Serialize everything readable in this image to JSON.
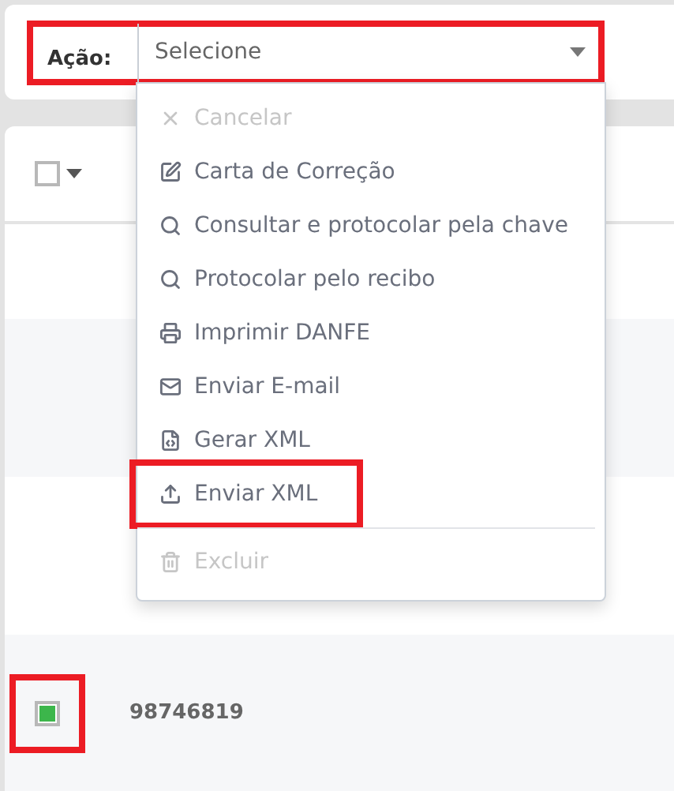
{
  "action_bar": {
    "label": "Ação:",
    "highlighted": true,
    "select": {
      "value": "Selecione",
      "expanded": true
    }
  },
  "menu": [
    {
      "kind": "times",
      "label": "Cancelar",
      "disabled": true,
      "highlighted": false
    },
    {
      "kind": "edit",
      "label": "Carta de Correção",
      "disabled": false,
      "highlighted": false
    },
    {
      "kind": "search",
      "label": "Consultar e protocolar pela chave",
      "disabled": false,
      "highlighted": false
    },
    {
      "kind": "search",
      "label": "Protocolar pelo recibo",
      "disabled": false,
      "highlighted": false
    },
    {
      "kind": "print",
      "label": "Imprimir DANFE",
      "disabled": false,
      "highlighted": false
    },
    {
      "kind": "mail",
      "label": "Enviar E-mail",
      "disabled": false,
      "highlighted": false
    },
    {
      "kind": "code",
      "label": "Gerar XML",
      "disabled": false,
      "highlighted": false
    },
    {
      "kind": "upload",
      "label": "Enviar XML",
      "disabled": false,
      "highlighted": true
    },
    {
      "kind": "divider"
    },
    {
      "kind": "trash",
      "label": "Excluir",
      "disabled": true,
      "highlighted": false
    }
  ],
  "table": {
    "header": {
      "checked": false
    },
    "rows": [
      {
        "number": "98746819",
        "checked": true,
        "highlighted": true
      }
    ]
  }
}
